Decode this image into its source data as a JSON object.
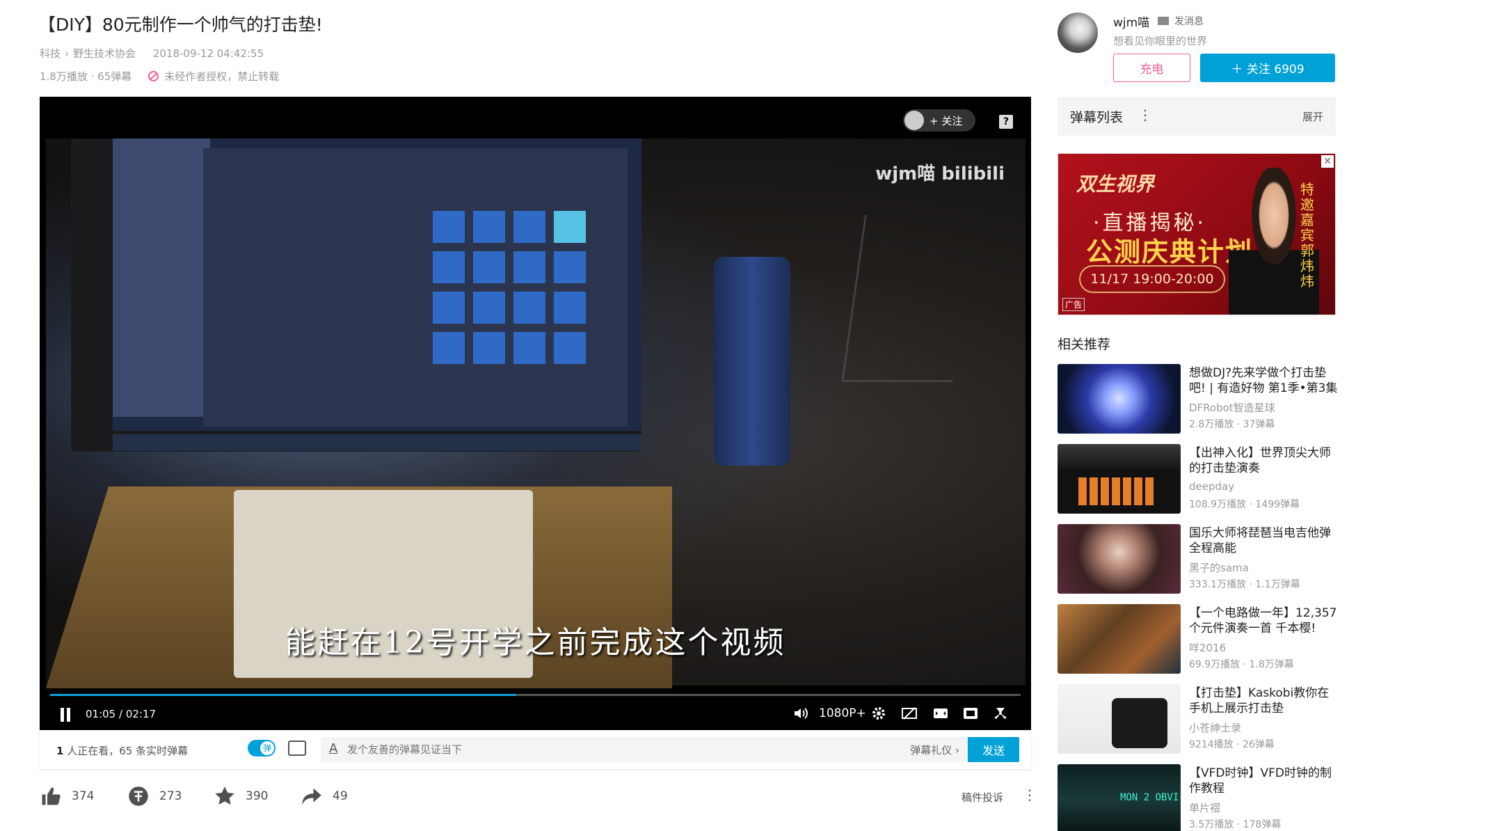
{
  "video": {
    "title": "【DIY】80元制作一个帅气的打击垫!",
    "category": "科技",
    "subcategory": "野生技术协会",
    "crumb_sep": "›",
    "date": "2018-09-12 04:42:55",
    "stats": "1.8万播放 · 65弹幕",
    "notice": "未经作者授权，禁止转载"
  },
  "player": {
    "watermark": "wjm喵 bilibili",
    "follow_label": "+ 关注",
    "help_label": "?",
    "subtitle": "能赶在12号开学之前完成这个视频",
    "progress_fraction": 0.48,
    "time_current": "01:05",
    "time_sep": "/",
    "time_total": "02:17",
    "quality": "1080P+"
  },
  "danmaku_bar": {
    "viewers_count": "1",
    "viewers_text": " 人正在看，",
    "realtime": "65 条实时弹幕",
    "font_icon": "A",
    "placeholder": "发个友善的弹幕见证当下",
    "etiquette": "弹幕礼仪 ›",
    "send": "发送"
  },
  "actions": {
    "like": "374",
    "coin": "273",
    "favorite": "390",
    "share": "49",
    "report": "稿件投诉",
    "more": "⋮"
  },
  "uploader": {
    "name": "wjm喵",
    "message": "发消息",
    "sign": "想看见你眼里的世界",
    "charge": "充电",
    "follow": "＋ 关注 6909"
  },
  "danmaku_list": {
    "title": "弹幕列表",
    "dots": "⋮",
    "expand": "展开"
  },
  "ad": {
    "logo": "双生视界",
    "line1": "·直播揭秘·",
    "line2": "公测庆典计划",
    "line3": "11/17 19:00-20:00",
    "guest": "特邀嘉宾郭炜炜",
    "badge": "广告",
    "close": "✕"
  },
  "related": {
    "title": "相关推荐",
    "items": [
      {
        "title": "想做DJ?先来学做个打击垫吧! | 有造好物 第1季•第3集",
        "author": "DFRobot智造星球",
        "stats": "2.8万播放 · 37弹幕"
      },
      {
        "title": "【出神入化】世界顶尖大师的打击垫演奏",
        "author": "deepday",
        "stats": "108.9万播放 · 1499弹幕"
      },
      {
        "title": "国乐大师将琵琶当电吉他弹全程高能",
        "author": "黑子的sama",
        "stats": "333.1万播放 · 1.1万弹幕"
      },
      {
        "title": "【一个电路做一年】12,357个元件演奏一首 千本樱!",
        "author": "咩2016",
        "stats": "69.9万播放 · 1.8万弹幕"
      },
      {
        "title": "【打击垫】Kaskobi教你在手机上展示打击垫",
        "author": "小苍绅士录",
        "stats": "9214播放 · 26弹幕"
      },
      {
        "title": "【VFD时钟】VFD时钟的制作教程",
        "author": "单片褶",
        "stats": "3.5万播放 · 178弹幕"
      }
    ]
  },
  "colors": {
    "accent": "#00a1d6",
    "pink": "#f25d8e"
  }
}
